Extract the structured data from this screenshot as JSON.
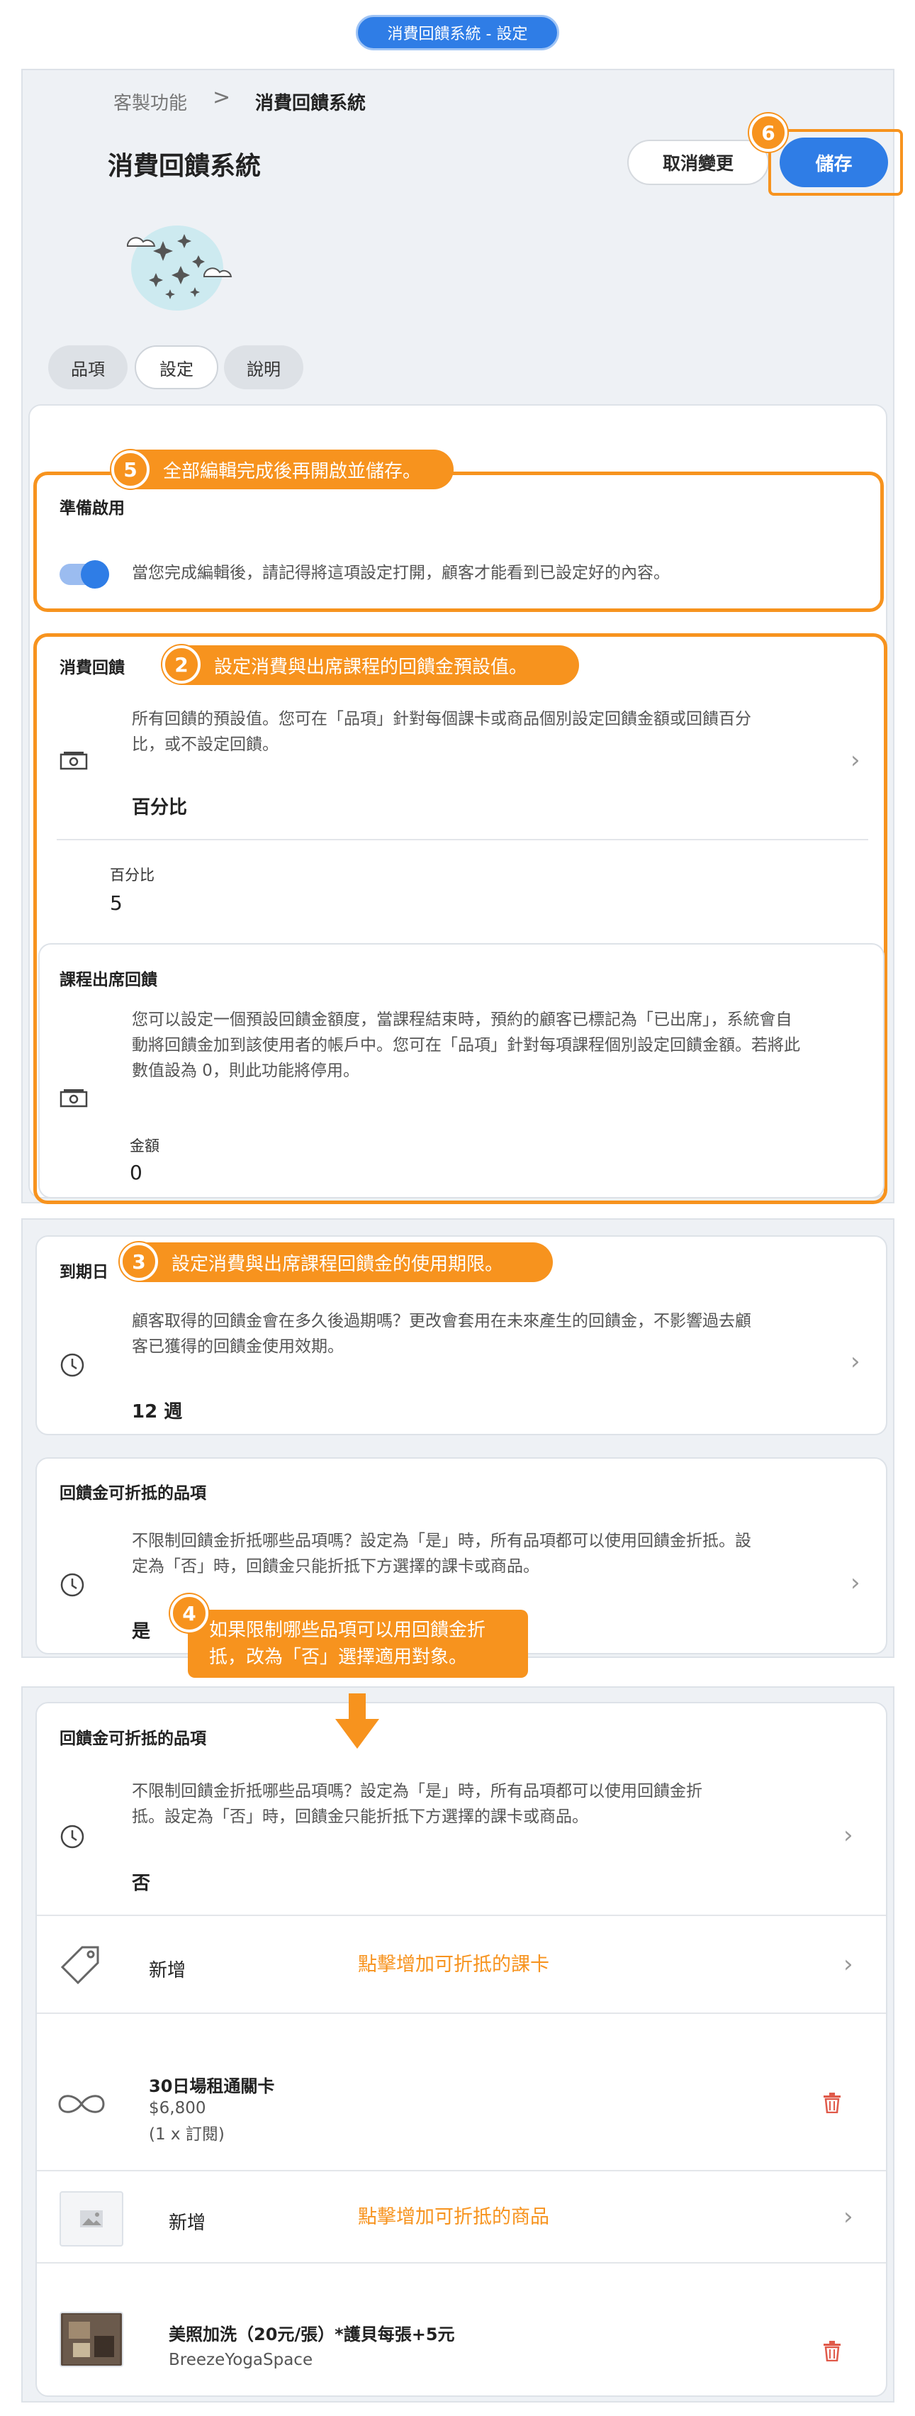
{
  "header_pill": "消費回饋系統 - 設定",
  "breadcrumb": {
    "root": "客製功能",
    "separator": ">",
    "current": "消費回饋系統"
  },
  "page_title": "消費回饋系統",
  "buttons": {
    "cancel": "取消變更",
    "save": "儲存"
  },
  "tabs": [
    {
      "label": "品項",
      "active": false
    },
    {
      "label": "設定",
      "active": true
    },
    {
      "label": "說明",
      "active": false
    }
  ],
  "callouts": {
    "c5": {
      "num": "5",
      "text": "全部編輯完成後再開啟並儲存。"
    },
    "c6": {
      "num": "6"
    },
    "c2": {
      "num": "2",
      "text": "設定消費與出席課程的回饋金預設值。"
    },
    "c3": {
      "num": "3",
      "text": "設定消費與出席課程回饋金的使用期限。"
    },
    "c4": {
      "num": "4",
      "line1": "如果限制哪些品項可以用回饋金折",
      "line2": "抵，改為「否」選擇適用對象。"
    }
  },
  "enable": {
    "title": "準備啟用",
    "desc": "當您完成編輯後，請記得將這項設定打開，顧客才能看到已設定好的內容。",
    "on": true
  },
  "rebate": {
    "title": "消費回饋",
    "desc1": "所有回饋的預設值。您可在「品項」針對每個課卡或商品個別設定回饋金額或回饋百分",
    "desc2": "比，或不設定回饋。",
    "value": "百分比",
    "field_label": "百分比",
    "field_value": "5"
  },
  "attendance": {
    "title": "課程出席回饋",
    "desc1": "您可以設定一個預設回饋金額度，當課程結束時，預約的顧客已標記為「已出席」，系統會自",
    "desc2": "動將回饋金加到該使用者的帳戶中。您可在「品項」針對每項課程個別設定回饋金額。若將此",
    "desc3": "數值設為 0，則此功能將停用。",
    "field_label": "金額",
    "field_value": "0"
  },
  "expiry": {
    "title": "到期日",
    "desc1": "顧客取得的回饋金會在多久後過期嗎？更改會套用在未來產生的回饋金，不影響過去顧",
    "desc2": "客已獲得的回饋金使用效期。",
    "value": "12 週"
  },
  "eligible_a": {
    "title": "回饋金可折抵的品項",
    "desc1": "不限制回饋金折抵哪些品項嗎？設定為「是」時，所有品項都可以使用回饋金折抵。設",
    "desc2": "定為「否」時，回饋金只能折抵下方選擇的課卡或商品。",
    "value": "是"
  },
  "eligible_b": {
    "title": "回饋金可折抵的品項",
    "desc1": "不限制回饋金折抵哪些品項嗎？設定為「是」時，所有品項都可以使用回饋金折",
    "desc2": "抵。設定為「否」時，回饋金只能折抵下方選擇的課卡或商品。",
    "value": "否",
    "add_card_label": "新增",
    "add_card_hint": "點擊增加可折抵的課卡",
    "card_item": {
      "name": "30日場租通關卡",
      "price": "$6,800",
      "qty": "(1 x 訂閱)"
    },
    "add_product_label": "新增",
    "add_product_hint": "點擊增加可折抵的商品",
    "product_item": {
      "name": "美照加洗（20元/張）*護貝每張+5元",
      "shop": "BreezeYogaSpace"
    }
  },
  "colors": {
    "accent": "#2f7de6",
    "annotation": "#f7931e",
    "delete": "#e05a4a"
  },
  "icons": [
    "chevron-right-icon",
    "money-icon",
    "clock-icon",
    "tag-icon",
    "infinity-icon",
    "trash-icon",
    "image-placeholder-icon",
    "down-arrow-icon"
  ]
}
